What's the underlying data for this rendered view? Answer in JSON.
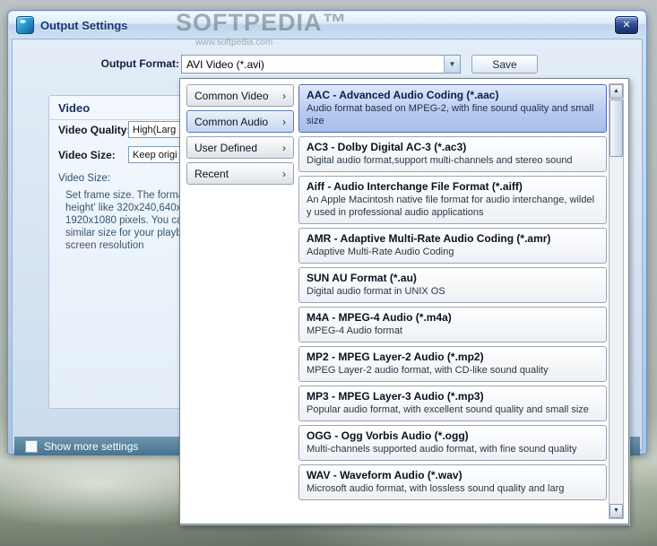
{
  "window": {
    "title": "Output Settings",
    "close_glyph": "✕"
  },
  "watermark": {
    "big": "SOFTPEDIA™",
    "small": "www.softpedia.com"
  },
  "toolbar": {
    "output_format_label": "Output Format:",
    "output_format_value": "AVI Video (*.avi)",
    "save_label": "Save"
  },
  "video_panel": {
    "title": "Video",
    "quality_label": "Video Quality:",
    "quality_value": "High(Larg",
    "size_label": "Video Size:",
    "size_value": "Keep origi",
    "description_heading": "Video Size:",
    "description_lines": [
      "Set frame size. The forma",
      "height' like 320x240,640x",
      "1920x1080 pixels. You ca",
      "similar size for your playb",
      "screen resolution"
    ]
  },
  "menu": {
    "categories": [
      {
        "label": "Common Video",
        "selected": false
      },
      {
        "label": "Common Audio",
        "selected": true
      },
      {
        "label": "User Defined",
        "selected": false
      },
      {
        "label": "Recent",
        "selected": false
      }
    ]
  },
  "formats": [
    {
      "title": "AAC - Advanced Audio Coding (*.aac)",
      "description": "Audio format based on MPEG-2, with fine sound quality and small size",
      "selected": true
    },
    {
      "title": "AC3 - Dolby Digital AC-3 (*.ac3)",
      "description": "Digital audio format,support multi-channels and stereo sound",
      "selected": false
    },
    {
      "title": "Aiff - Audio Interchange File Format (*.aiff)",
      "description": "An Apple Macintosh native file format for audio interchange, wildely used in professional audio applications",
      "selected": false
    },
    {
      "title": "AMR - Adaptive Multi-Rate Audio Coding (*.amr)",
      "description": "Adaptive Multi-Rate Audio Coding",
      "selected": false
    },
    {
      "title": "SUN AU Format (*.au)",
      "description": "Digital audio format in UNIX OS",
      "selected": false
    },
    {
      "title": "M4A - MPEG-4 Audio (*.m4a)",
      "description": "MPEG-4 Audio format",
      "selected": false
    },
    {
      "title": "MP2 - MPEG Layer-2 Audio (*.mp2)",
      "description": "MPEG Layer-2 audio format, with CD-like sound quality",
      "selected": false
    },
    {
      "title": "MP3 - MPEG Layer-3 Audio (*.mp3)",
      "description": "Popular audio format, with excellent sound quality and small size",
      "selected": false
    },
    {
      "title": "OGG - Ogg Vorbis Audio (*.ogg)",
      "description": "Multi-channels supported audio format, with fine sound quality",
      "selected": false
    },
    {
      "title": "WAV - Waveform Audio (*.wav)",
      "description": "Microsoft audio format, with lossless sound quality and larg",
      "selected": false
    }
  ],
  "footer": {
    "show_more_label": "Show more settings"
  },
  "scrollbar": {
    "up_glyph": "▲",
    "down_glyph": "▼"
  }
}
